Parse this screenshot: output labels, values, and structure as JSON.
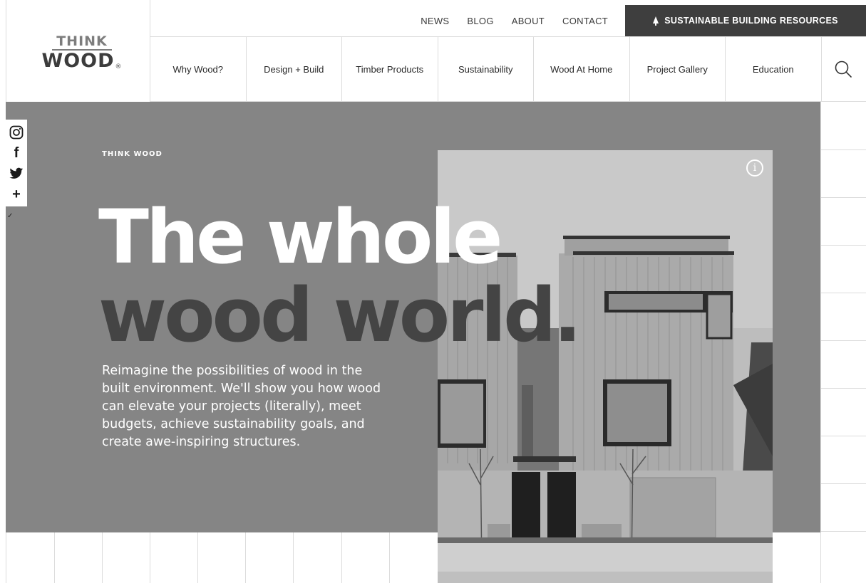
{
  "logo": {
    "line1": "THINK",
    "line2": "WOOD",
    "mark": "®"
  },
  "top_links": [
    "NEWS",
    "BLOG",
    "ABOUT",
    "CONTACT"
  ],
  "resources_button": {
    "label": "SUSTAINABLE BUILDING RESOURCES",
    "icon": "tree-icon"
  },
  "nav": [
    "Why Wood?",
    "Design + Build",
    "Timber Products",
    "Sustainability",
    "Wood At Home",
    "Project Gallery",
    "Education"
  ],
  "search": {
    "icon": "search-icon"
  },
  "social": [
    {
      "name": "instagram",
      "icon": "instagram-icon"
    },
    {
      "name": "facebook",
      "icon": "facebook-icon",
      "glyph": "f"
    },
    {
      "name": "twitter",
      "icon": "twitter-icon"
    },
    {
      "name": "share",
      "icon": "plus-icon",
      "glyph": "+"
    }
  ],
  "hero": {
    "eyebrow": "THINK WOOD",
    "headline_line1": "The whole",
    "headline_line2": "wood world.",
    "intro": "Reimagine the possibilities of wood in the built environment. We'll show you how wood can elevate your projects (literally), meet budgets, achieve sustainability goals, and create awe-inspiring structures.",
    "info_glyph": "i"
  },
  "colors": {
    "hero_bg": "#858585",
    "resources_bg": "#3e3e3e",
    "headline_dark": "#444444"
  }
}
